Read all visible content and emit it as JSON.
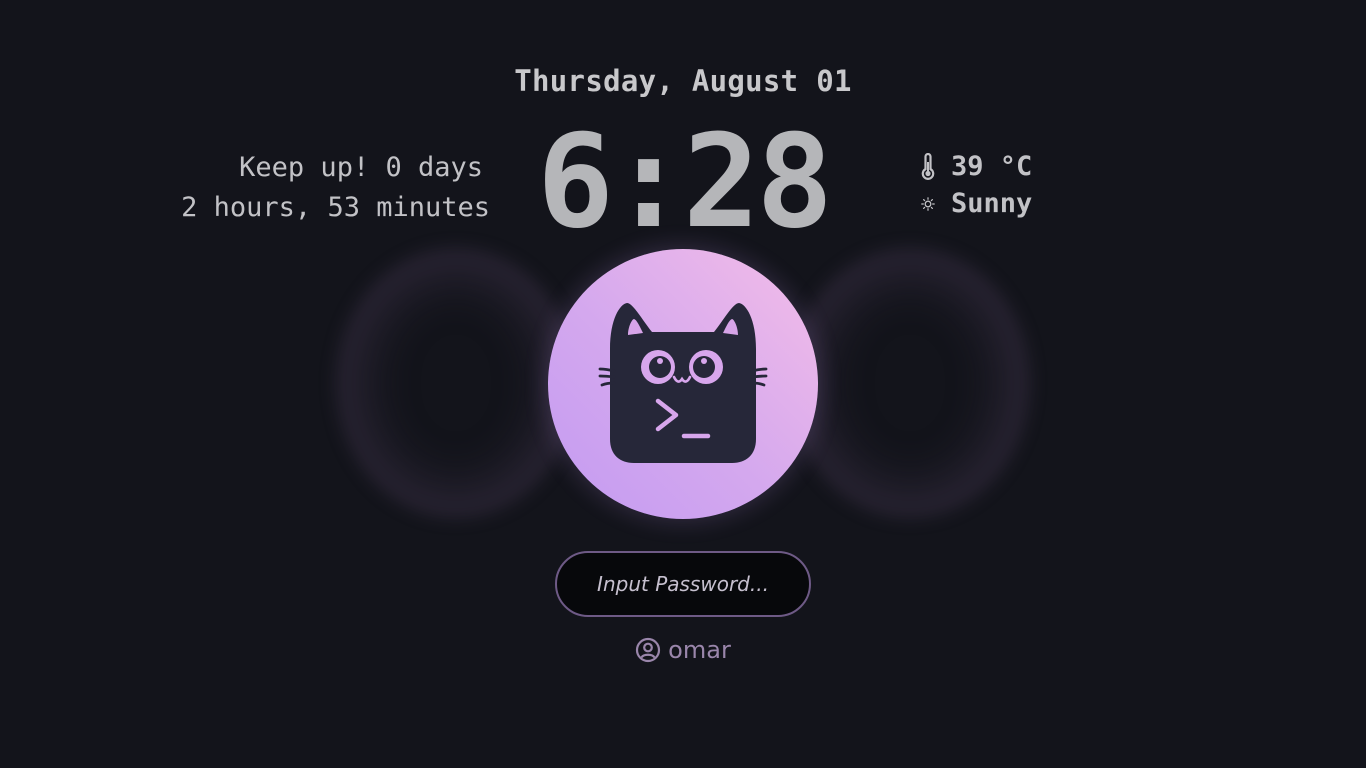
{
  "lockscreen": {
    "date": "Thursday, August 01",
    "time": "6:28",
    "uptime": {
      "line1": "Keep up! 0 days",
      "line2": "2 hours, 53 minutes"
    },
    "weather": {
      "temperature": "39 °C",
      "temperature_icon": "thermometer-icon",
      "condition": "Sunny",
      "condition_icon": "sun-icon"
    },
    "avatar": {
      "icon": "cat-terminal-icon",
      "gradient": [
        "#c39af2",
        "#f4bde8"
      ],
      "fill": "#262739"
    },
    "password": {
      "placeholder": "Input Password..."
    },
    "user": {
      "icon": "user-circle-icon",
      "name": "omar"
    }
  },
  "colors": {
    "background": "#13141b",
    "text": "#c2c2c6",
    "clock": "#b5b6b9",
    "accent": "#9a86ab",
    "input_border": "#6e5a86",
    "input_bg": "#07080b"
  }
}
